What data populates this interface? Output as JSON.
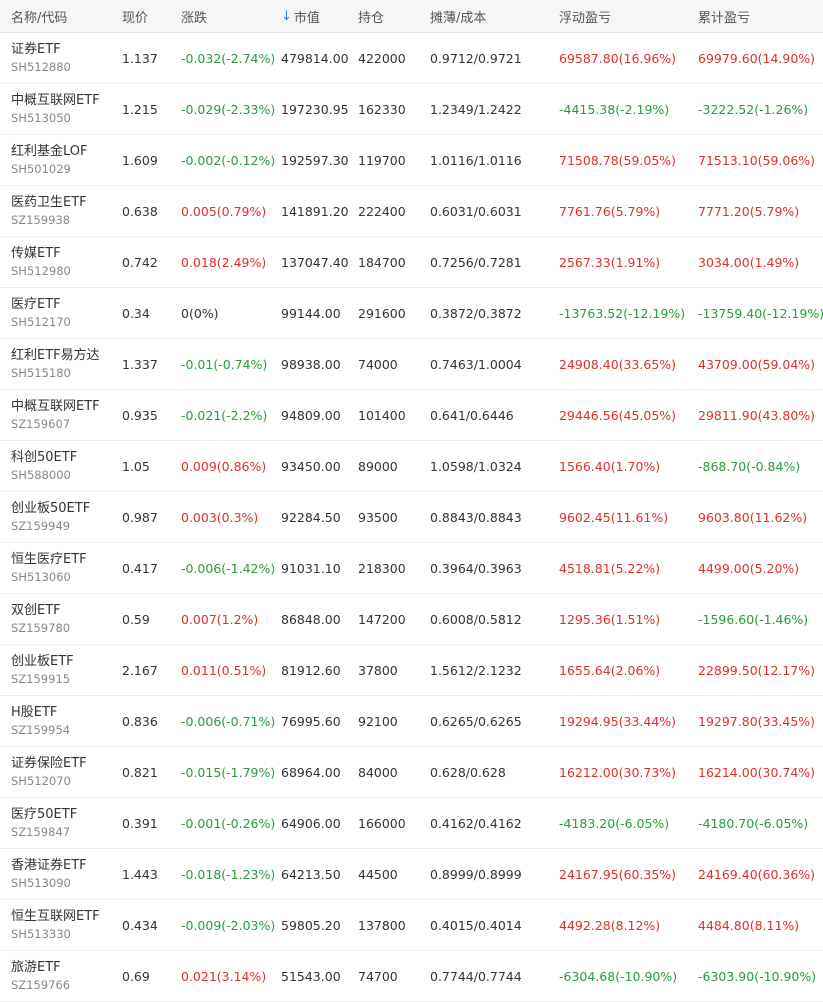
{
  "colors": {
    "up": "#e0302a",
    "down": "#2a9b3e",
    "sort_icon": "#3b7fd9"
  },
  "header": {
    "name_code": "名称/代码",
    "price": "现价",
    "change": "涨跌",
    "market_value": "市值",
    "market_value_sort_icon": "arrow-down-icon",
    "position": "持仓",
    "cost": "摊薄/成本",
    "floating_pl": "浮动盈亏",
    "cumulative_pl": "累计盈亏"
  },
  "rows": [
    {
      "name": "证券ETF",
      "code": "SH512880",
      "price": "1.137",
      "change": "-0.032(-2.74%)",
      "change_dir": "down",
      "market_value": "479814.00",
      "position": "422000",
      "cost": "0.9712/0.9721",
      "floating_pl": "69587.80(16.96%)",
      "floating_dir": "up",
      "cumulative_pl": "69979.60(14.90%)",
      "cumulative_dir": "up"
    },
    {
      "name": "中概互联网ETF",
      "code": "SH513050",
      "price": "1.215",
      "change": "-0.029(-2.33%)",
      "change_dir": "down",
      "market_value": "197230.95",
      "position": "162330",
      "cost": "1.2349/1.2422",
      "floating_pl": "-4415.38(-2.19%)",
      "floating_dir": "down",
      "cumulative_pl": "-3222.52(-1.26%)",
      "cumulative_dir": "down"
    },
    {
      "name": "红利基金LOF",
      "code": "SH501029",
      "price": "1.609",
      "change": "-0.002(-0.12%)",
      "change_dir": "down",
      "market_value": "192597.30",
      "position": "119700",
      "cost": "1.0116/1.0116",
      "floating_pl": "71508.78(59.05%)",
      "floating_dir": "up",
      "cumulative_pl": "71513.10(59.06%)",
      "cumulative_dir": "up"
    },
    {
      "name": "医药卫生ETF",
      "code": "SZ159938",
      "price": "0.638",
      "change": "0.005(0.79%)",
      "change_dir": "up",
      "market_value": "141891.20",
      "position": "222400",
      "cost": "0.6031/0.6031",
      "floating_pl": "7761.76(5.79%)",
      "floating_dir": "up",
      "cumulative_pl": "7771.20(5.79%)",
      "cumulative_dir": "up"
    },
    {
      "name": "传媒ETF",
      "code": "SH512980",
      "price": "0.742",
      "change": "0.018(2.49%)",
      "change_dir": "up",
      "market_value": "137047.40",
      "position": "184700",
      "cost": "0.7256/0.7281",
      "floating_pl": "2567.33(1.91%)",
      "floating_dir": "up",
      "cumulative_pl": "3034.00(1.49%)",
      "cumulative_dir": "up"
    },
    {
      "name": "医疗ETF",
      "code": "SH512170",
      "price": "0.34",
      "change": "0(0%)",
      "change_dir": "flat",
      "market_value": "99144.00",
      "position": "291600",
      "cost": "0.3872/0.3872",
      "floating_pl": "-13763.52(-12.19%)",
      "floating_dir": "down",
      "cumulative_pl": "-13759.40(-12.19%)",
      "cumulative_dir": "down"
    },
    {
      "name": "红利ETF易方达",
      "code": "SH515180",
      "price": "1.337",
      "change": "-0.01(-0.74%)",
      "change_dir": "down",
      "market_value": "98938.00",
      "position": "74000",
      "cost": "0.7463/1.0004",
      "floating_pl": "24908.40(33.65%)",
      "floating_dir": "up",
      "cumulative_pl": "43709.00(59.04%)",
      "cumulative_dir": "up"
    },
    {
      "name": "中概互联网ETF",
      "code": "SZ159607",
      "price": "0.935",
      "change": "-0.021(-2.2%)",
      "change_dir": "down",
      "market_value": "94809.00",
      "position": "101400",
      "cost": "0.641/0.6446",
      "floating_pl": "29446.56(45.05%)",
      "floating_dir": "up",
      "cumulative_pl": "29811.90(43.80%)",
      "cumulative_dir": "up"
    },
    {
      "name": "科创50ETF",
      "code": "SH588000",
      "price": "1.05",
      "change": "0.009(0.86%)",
      "change_dir": "up",
      "market_value": "93450.00",
      "position": "89000",
      "cost": "1.0598/1.0324",
      "floating_pl": "1566.40(1.70%)",
      "floating_dir": "up",
      "cumulative_pl": "-868.70(-0.84%)",
      "cumulative_dir": "down"
    },
    {
      "name": "创业板50ETF",
      "code": "SZ159949",
      "price": "0.987",
      "change": "0.003(0.3%)",
      "change_dir": "up",
      "market_value": "92284.50",
      "position": "93500",
      "cost": "0.8843/0.8843",
      "floating_pl": "9602.45(11.61%)",
      "floating_dir": "up",
      "cumulative_pl": "9603.80(11.62%)",
      "cumulative_dir": "up"
    },
    {
      "name": "恒生医疗ETF",
      "code": "SH513060",
      "price": "0.417",
      "change": "-0.006(-1.42%)",
      "change_dir": "down",
      "market_value": "91031.10",
      "position": "218300",
      "cost": "0.3964/0.3963",
      "floating_pl": "4518.81(5.22%)",
      "floating_dir": "up",
      "cumulative_pl": "4499.00(5.20%)",
      "cumulative_dir": "up"
    },
    {
      "name": "双创ETF",
      "code": "SZ159780",
      "price": "0.59",
      "change": "0.007(1.2%)",
      "change_dir": "up",
      "market_value": "86848.00",
      "position": "147200",
      "cost": "0.6008/0.5812",
      "floating_pl": "1295.36(1.51%)",
      "floating_dir": "up",
      "cumulative_pl": "-1596.60(-1.46%)",
      "cumulative_dir": "down"
    },
    {
      "name": "创业板ETF",
      "code": "SZ159915",
      "price": "2.167",
      "change": "0.011(0.51%)",
      "change_dir": "up",
      "market_value": "81912.60",
      "position": "37800",
      "cost": "1.5612/2.1232",
      "floating_pl": "1655.64(2.06%)",
      "floating_dir": "up",
      "cumulative_pl": "22899.50(12.17%)",
      "cumulative_dir": "up"
    },
    {
      "name": "H股ETF",
      "code": "SZ159954",
      "price": "0.836",
      "change": "-0.006(-0.71%)",
      "change_dir": "down",
      "market_value": "76995.60",
      "position": "92100",
      "cost": "0.6265/0.6265",
      "floating_pl": "19294.95(33.44%)",
      "floating_dir": "up",
      "cumulative_pl": "19297.80(33.45%)",
      "cumulative_dir": "up"
    },
    {
      "name": "证券保险ETF",
      "code": "SH512070",
      "price": "0.821",
      "change": "-0.015(-1.79%)",
      "change_dir": "down",
      "market_value": "68964.00",
      "position": "84000",
      "cost": "0.628/0.628",
      "floating_pl": "16212.00(30.73%)",
      "floating_dir": "up",
      "cumulative_pl": "16214.00(30.74%)",
      "cumulative_dir": "up"
    },
    {
      "name": "医疗50ETF",
      "code": "SZ159847",
      "price": "0.391",
      "change": "-0.001(-0.26%)",
      "change_dir": "down",
      "market_value": "64906.00",
      "position": "166000",
      "cost": "0.4162/0.4162",
      "floating_pl": "-4183.20(-6.05%)",
      "floating_dir": "down",
      "cumulative_pl": "-4180.70(-6.05%)",
      "cumulative_dir": "down"
    },
    {
      "name": "香港证券ETF",
      "code": "SH513090",
      "price": "1.443",
      "change": "-0.018(-1.23%)",
      "change_dir": "down",
      "market_value": "64213.50",
      "position": "44500",
      "cost": "0.8999/0.8999",
      "floating_pl": "24167.95(60.35%)",
      "floating_dir": "up",
      "cumulative_pl": "24169.40(60.36%)",
      "cumulative_dir": "up"
    },
    {
      "name": "恒生互联网ETF",
      "code": "SH513330",
      "price": "0.434",
      "change": "-0.009(-2.03%)",
      "change_dir": "down",
      "market_value": "59805.20",
      "position": "137800",
      "cost": "0.4015/0.4014",
      "floating_pl": "4492.28(8.12%)",
      "floating_dir": "up",
      "cumulative_pl": "4484.80(8.11%)",
      "cumulative_dir": "up"
    },
    {
      "name": "旅游ETF",
      "code": "SZ159766",
      "price": "0.69",
      "change": "0.021(3.14%)",
      "change_dir": "up",
      "market_value": "51543.00",
      "position": "74700",
      "cost": "0.7744/0.7744",
      "floating_pl": "-6304.68(-10.90%)",
      "floating_dir": "down",
      "cumulative_pl": "-6303.90(-10.90%)",
      "cumulative_dir": "down"
    }
  ]
}
